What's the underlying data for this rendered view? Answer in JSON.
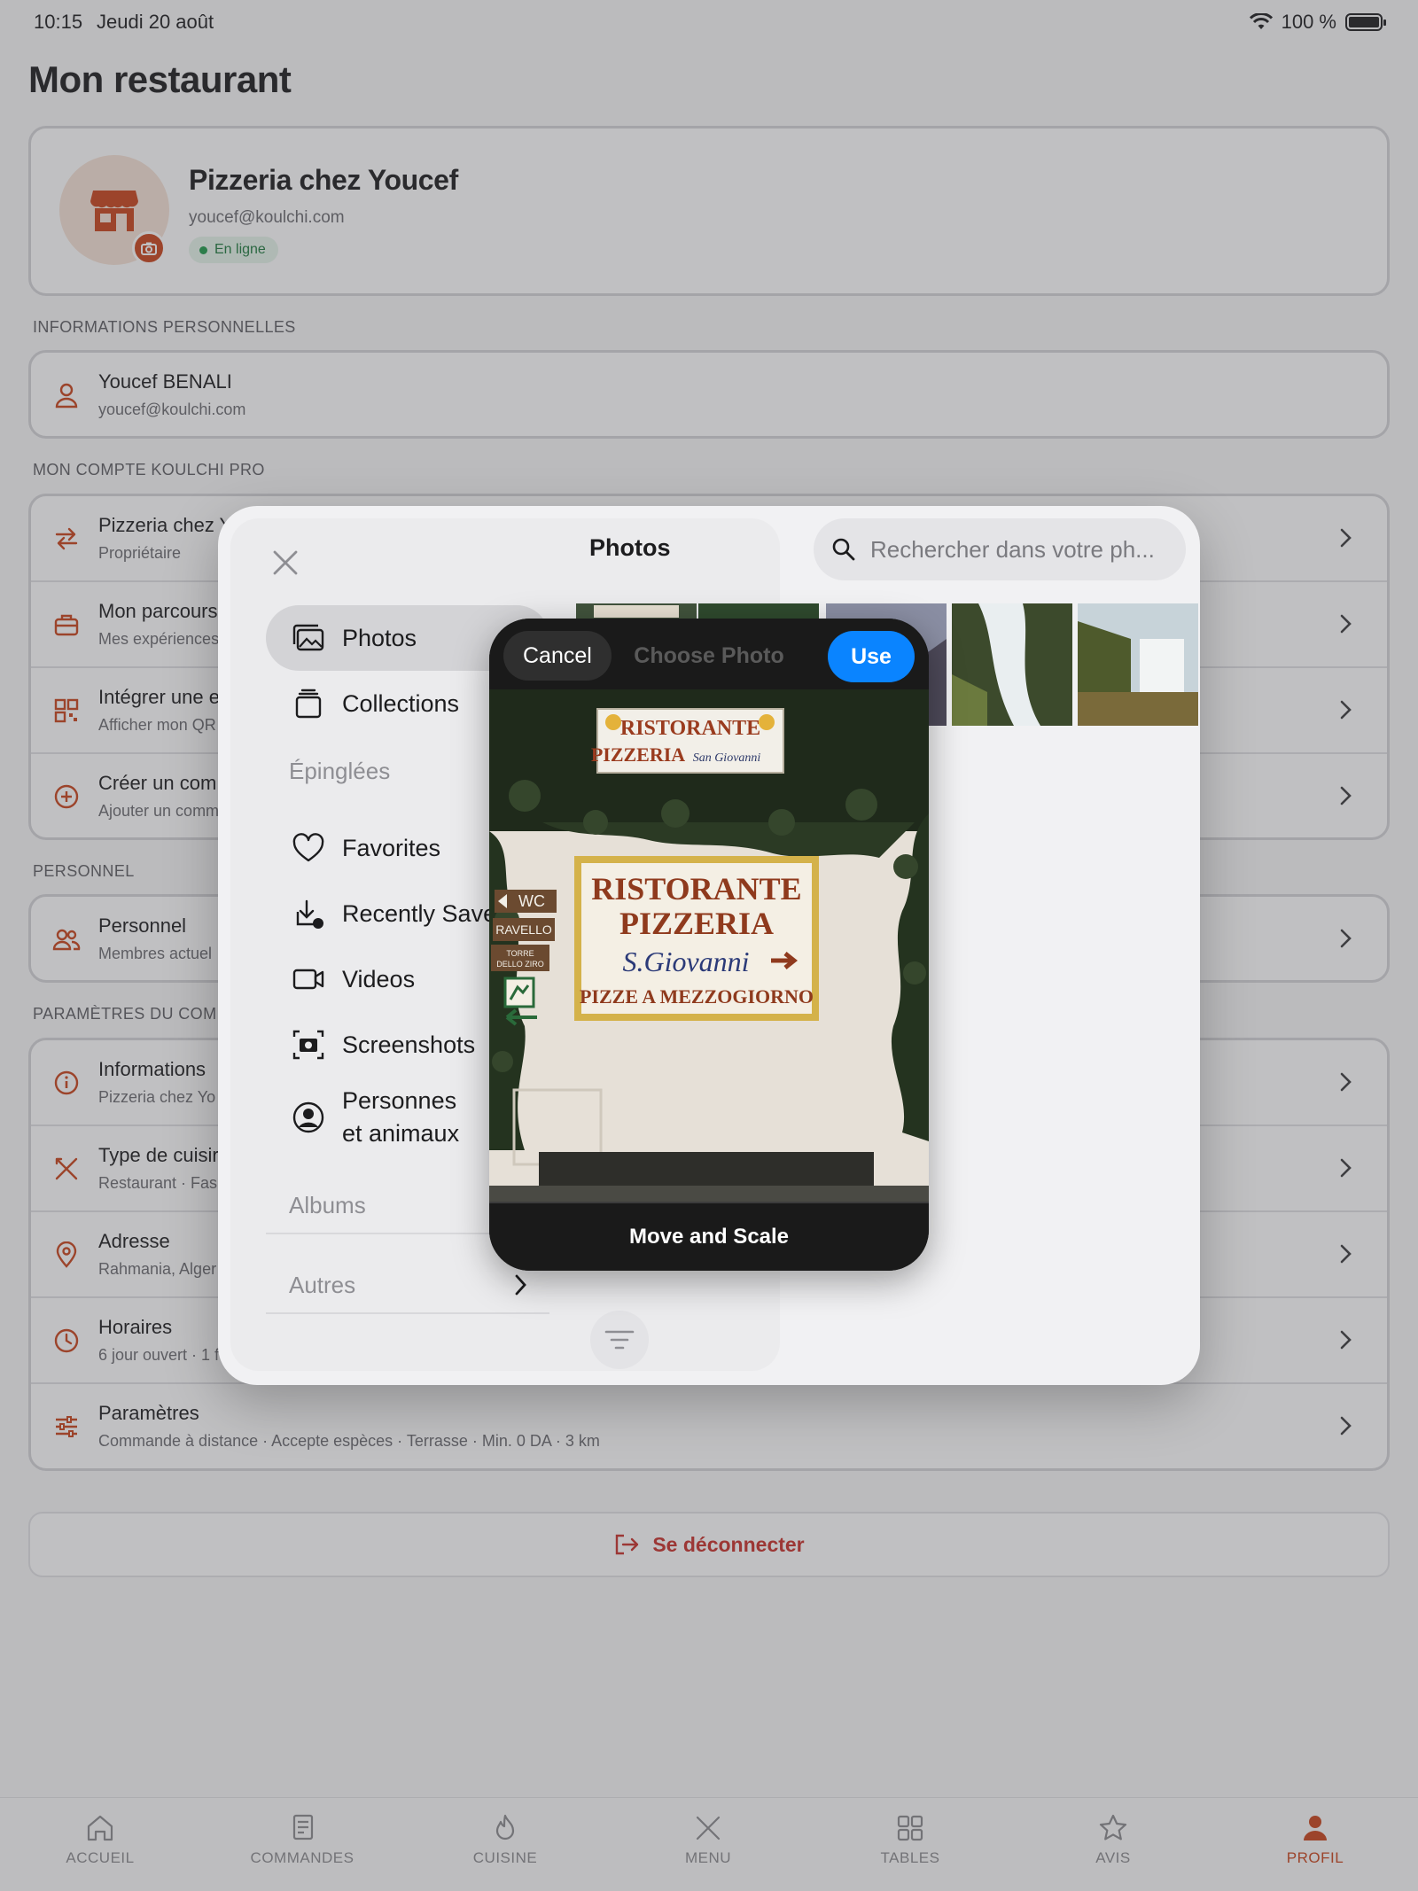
{
  "status_bar": {
    "time": "10:15",
    "date": "Jeudi 20 août",
    "battery": "100 %"
  },
  "page": {
    "title": "Mon restaurant"
  },
  "profile": {
    "name": "Pizzeria chez Youcef",
    "email": "youcef@koulchi.com",
    "status": "En ligne"
  },
  "sections": {
    "personal_info": "INFORMATIONS PERSONNELLES",
    "account": "MON COMPTE KOULCHI PRO",
    "staff": "PERSONNEL",
    "settings": "PARAMÈTRES DU COM"
  },
  "personal_info": {
    "name": "Youcef BENALI",
    "email": "youcef@koulchi.com"
  },
  "account_rows": [
    {
      "title": "Pizzeria chez Y",
      "subtitle": "Propriétaire",
      "icon": "swap-icon"
    },
    {
      "title": "Mon parcours",
      "subtitle": "Mes expériences",
      "icon": "briefcase-icon"
    },
    {
      "title": "Intégrer une e",
      "subtitle": "Afficher mon QR",
      "icon": "qr-code-icon"
    },
    {
      "title": "Créer un com",
      "subtitle": "Ajouter un comm",
      "icon": "plus-circle-icon"
    }
  ],
  "staff_row": {
    "title": "Personnel",
    "subtitle": "Membres actuel",
    "icon": "people-icon"
  },
  "settings_rows": [
    {
      "title": "Informations",
      "subtitle": "Pizzeria chez Yo",
      "icon": "info-icon"
    },
    {
      "title": "Type de cuisir",
      "subtitle": "Restaurant · Fas",
      "icon": "utensils-icon"
    },
    {
      "title": "Adresse",
      "subtitle": "Rahmania, Alger",
      "icon": "pin-icon"
    },
    {
      "title": "Horaires",
      "subtitle": "6 jour ouvert · 1 fe",
      "icon": "clock-icon"
    },
    {
      "title": "Paramètres",
      "subtitle": "Commande à distance · Accepte espèces · Terrasse · Min. 0 DA · 3 km",
      "icon": "sliders-icon"
    }
  ],
  "logout": {
    "label": "Se déconnecter"
  },
  "tabbar": [
    {
      "label": "ACCUEIL",
      "icon": "home-icon"
    },
    {
      "label": "COMMANDES",
      "icon": "receipt-icon"
    },
    {
      "label": "CUISINE",
      "icon": "flame-icon"
    },
    {
      "label": "MENU",
      "icon": "utensils-icon"
    },
    {
      "label": "TABLES",
      "icon": "grid-icon"
    },
    {
      "label": "AVIS",
      "icon": "star-icon"
    },
    {
      "label": "PROFIL",
      "icon": "person-icon",
      "active": true
    }
  ],
  "picker": {
    "title": "Photos",
    "search_placeholder": "Rechercher dans votre ph...",
    "sidebar": {
      "photos": "Photos",
      "collections": "Collections",
      "pinned_heading": "Épinglées",
      "favorites": "Favorites",
      "recently_saved": "Recently Saved",
      "videos": "Videos",
      "screenshots": "Screenshots",
      "people_line1": "Personnes",
      "people_line2": "et animaux",
      "albums_heading": "Albums",
      "others": "Autres"
    }
  },
  "crop": {
    "cancel": "Cancel",
    "title": "Choose Photo",
    "use": "Use",
    "footer": "Move and Scale",
    "sign_small_line1": "RISTORANTE",
    "sign_small_line2": "PIZZERIA",
    "sign_small_line3": "San Giovanni",
    "sign_big_line1": "RISTORANTE",
    "sign_big_line2": "PIZZERIA",
    "sign_big_line3": "S.Giovanni",
    "sign_big_line4": "PIZZE A MEZZOGIORNO",
    "wc": "WC",
    "ravello": "RAVELLO",
    "torre": "TORRE",
    "dello_ziro": "DELLO ZIRO"
  },
  "colors": {
    "accent": "#c8441b",
    "use_button": "#0a84ff",
    "online": "#1e7a3d",
    "logout": "#c8302a"
  }
}
